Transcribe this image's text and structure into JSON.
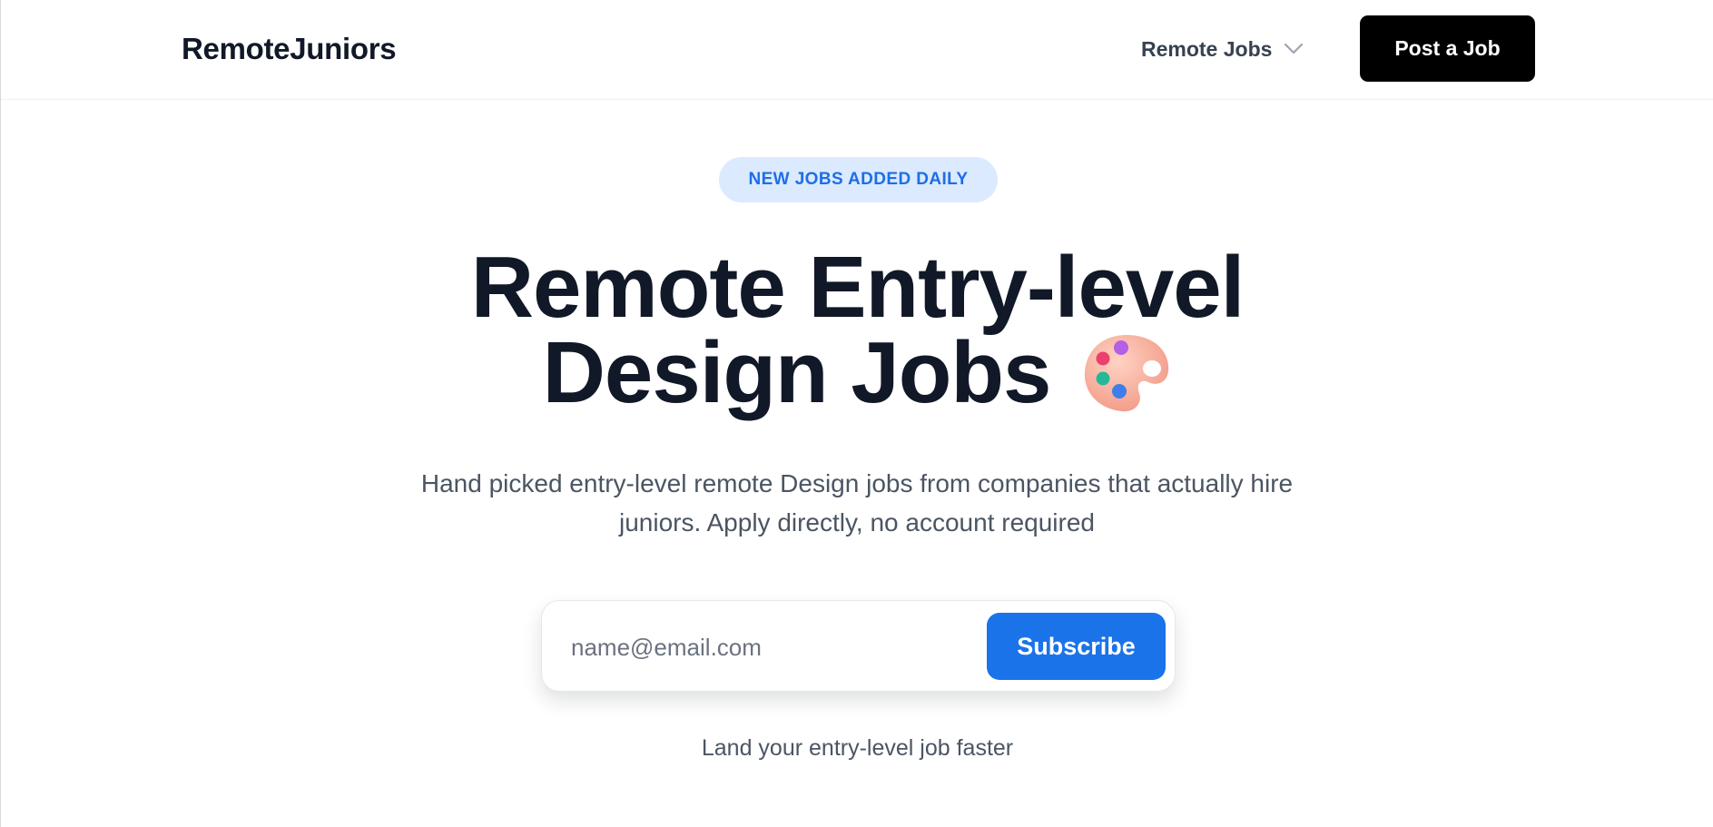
{
  "header": {
    "logo": "RemoteJuniors",
    "nav": {
      "remote_jobs_label": "Remote Jobs",
      "dropdown_icon": "chevron-down-icon"
    },
    "post_job_label": "Post a Job"
  },
  "hero": {
    "badge": "NEW JOBS ADDED DAILY",
    "headline_line1": "Remote Entry-level",
    "headline_line2": "Design Jobs",
    "headline_icon": "artist-palette-icon",
    "subtitle": "Hand picked entry-level remote Design jobs from companies that actually hire juniors. Apply directly, no account required"
  },
  "subscribe": {
    "email_placeholder": "name@email.com",
    "email_value": "",
    "button_label": "Subscribe"
  },
  "tagline": "Land your entry-level job faster",
  "colors": {
    "text_dark": "#111827",
    "text_muted": "#4b5563",
    "accent_blue": "#1a73e8",
    "badge_bg": "#dbeafe",
    "post_button_bg": "#000000"
  }
}
